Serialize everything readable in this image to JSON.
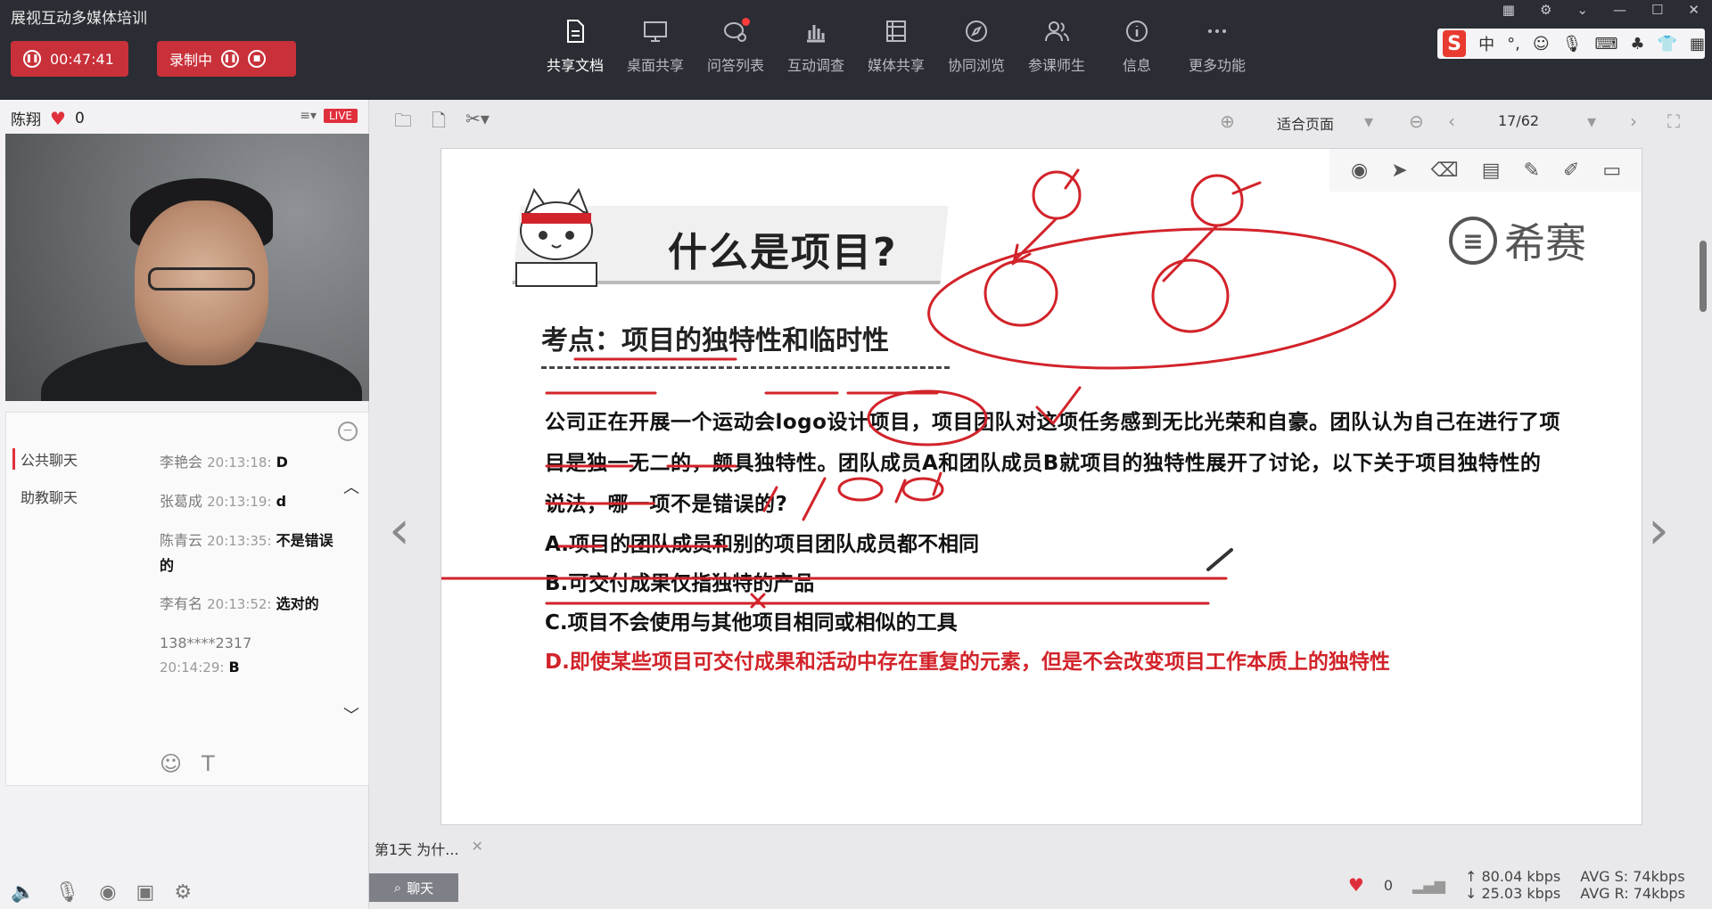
{
  "app": {
    "title": "展视互动多媒体培训"
  },
  "recording": {
    "timer": "00:47:41",
    "rec_label": "录制中"
  },
  "toolbar": [
    {
      "label": "共享文档",
      "icon": "document-icon"
    },
    {
      "label": "桌面共享",
      "icon": "monitor-icon"
    },
    {
      "label": "问答列表",
      "icon": "qa-icon"
    },
    {
      "label": "互动调查",
      "icon": "bar-chart-icon"
    },
    {
      "label": "媒体共享",
      "icon": "film-icon"
    },
    {
      "label": "协同浏览",
      "icon": "compass-icon"
    },
    {
      "label": "参课师生",
      "icon": "users-icon"
    },
    {
      "label": "信息",
      "icon": "info-icon"
    },
    {
      "label": "更多功能",
      "icon": "more-icon"
    }
  ],
  "ime": {
    "lang": "中"
  },
  "presenter": {
    "name": "陈翔",
    "likes": "0",
    "live": "LIVE"
  },
  "chat": {
    "tabs": [
      "公共聊天",
      "助教聊天"
    ],
    "messages": [
      {
        "user": "李艳会",
        "time": "20:13:18:",
        "text": "D"
      },
      {
        "user": "张葛成",
        "time": "20:13:19:",
        "text": "d"
      },
      {
        "user": "陈青云",
        "time": "20:13:35:",
        "text": "不是错误的"
      },
      {
        "user": "李有名",
        "time": "20:13:52:",
        "text": "选对的"
      },
      {
        "user": "138****2317",
        "time": "20:14:29:",
        "text": "B"
      }
    ]
  },
  "viewer": {
    "fit": "适合页面",
    "page": "17/62"
  },
  "slide": {
    "title": "什么是项目?",
    "brand": "希赛",
    "kaodian": "考点：项目的独特性和临时性",
    "question": "公司正在开展一个运动会logo设计项目，项目团队对这项任务感到无比光荣和自豪。团队认为自己在进行了项目是独一无二的，颇具独特性。团队成员A和团队成员B就项目的独特性展开了讨论，以下关于项目独特性的说法，哪一项不是错误的?",
    "options": {
      "a": "A.项目的团队成员和别的项目团队成员都不相同",
      "b": "B.可交付成果仅指独特的产品",
      "c": "C.项目不会使用与其他项目相同或相似的工具",
      "d": "D.即使某些项目可交付成果和活动中存在重复的元素，但是不会改变项目工作本质上的独特性"
    }
  },
  "doc_tab": {
    "label": "第1天 为什..."
  },
  "chat_button": "聊天",
  "stats": {
    "likes": "0",
    "up": "80.04 kbps",
    "down": "25.03 kbps",
    "avg_s": "AVG S: 74kbps",
    "avg_r": "AVG R: 74kbps"
  },
  "colors": {
    "accent": "#c8313a",
    "ink": "#d2232a",
    "topbar": "#2a2d33"
  }
}
